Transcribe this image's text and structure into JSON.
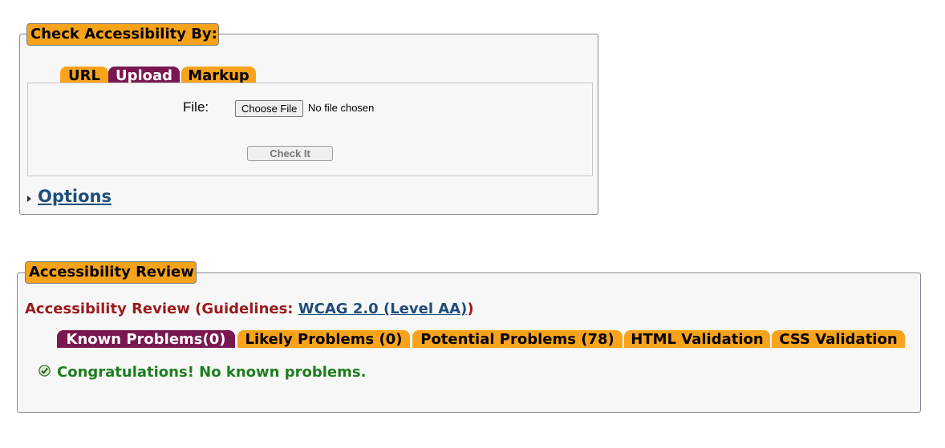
{
  "check_section": {
    "legend": "Check Accessibility By:",
    "tabs": [
      {
        "label": "URL",
        "active": false
      },
      {
        "label": "Upload",
        "active": true
      },
      {
        "label": "Markup",
        "active": false
      }
    ],
    "file_label": "File:",
    "choose_file_label": "Choose File",
    "no_file_text": "No file chosen",
    "check_button_label": "Check It",
    "options_link": "Options"
  },
  "review_section": {
    "legend": "Accessibility Review",
    "heading_prefix": "Accessibility Review (Guidelines: ",
    "guideline_link": "WCAG 2.0 (Level AA)",
    "heading_suffix": ")",
    "tabs": [
      {
        "label": "Known Problems(0)",
        "active": true
      },
      {
        "label": "Likely Problems (0)",
        "active": false
      },
      {
        "label": "Potential Problems (78)",
        "active": false
      },
      {
        "label": "HTML Validation",
        "active": false
      },
      {
        "label": "CSS Validation",
        "active": false
      }
    ],
    "message": "Congratulations! No known problems."
  },
  "colors": {
    "tab_orange": "#f9a31c",
    "tab_active": "#7a1750",
    "heading_red": "#9b1b1b",
    "link_blue": "#1f4e79",
    "success_green": "#1e7d1e"
  }
}
